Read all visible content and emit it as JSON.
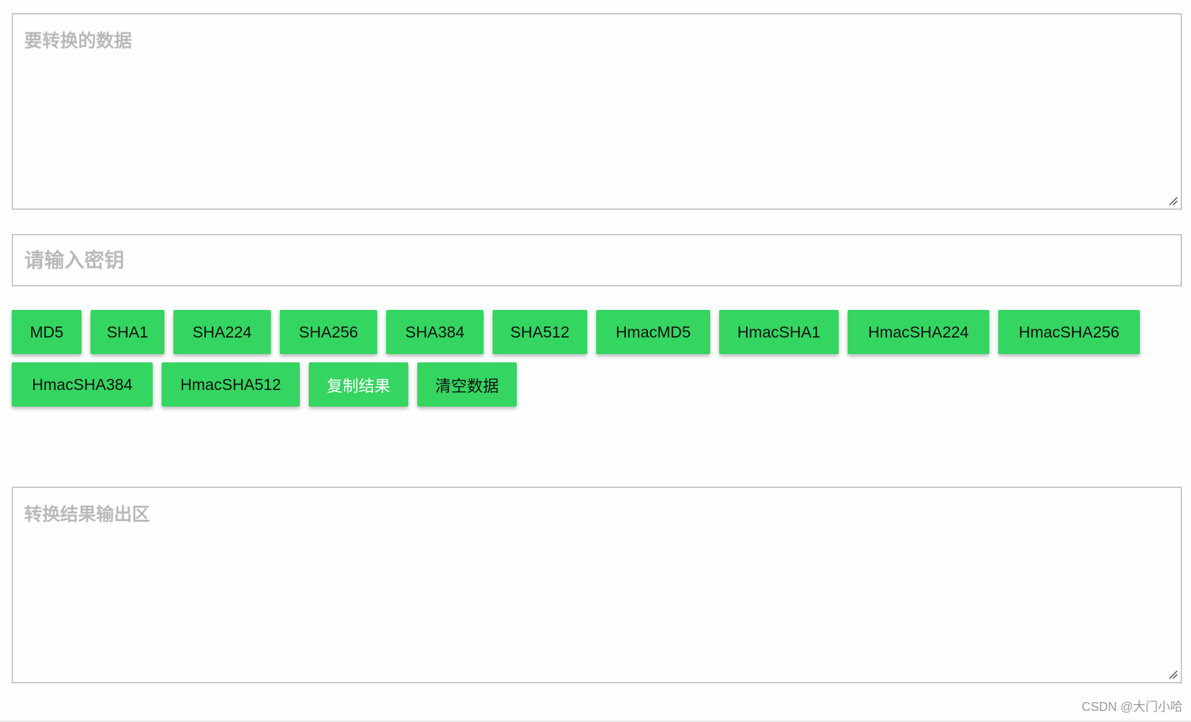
{
  "input_area": {
    "placeholder": "要转换的数据",
    "value": ""
  },
  "key_input": {
    "placeholder": "请输入密钥",
    "value": ""
  },
  "buttons_row1": [
    {
      "label": "MD5"
    },
    {
      "label": "SHA1"
    },
    {
      "label": "SHA224"
    },
    {
      "label": "SHA256"
    },
    {
      "label": "SHA384"
    },
    {
      "label": "SHA512"
    },
    {
      "label": "HmacMD5"
    },
    {
      "label": "HmacSHA1"
    },
    {
      "label": "HmacSHA224"
    },
    {
      "label": "HmacSHA256"
    }
  ],
  "buttons_row2": [
    {
      "label": "HmacSHA384"
    },
    {
      "label": "HmacSHA512"
    },
    {
      "label": "复制结果"
    },
    {
      "label": "清空数据"
    }
  ],
  "output_area": {
    "placeholder": "转换结果输出区",
    "value": ""
  },
  "watermark": "CSDN @大门小哈",
  "colors": {
    "button_bg": "#35d562",
    "border": "#c8c8c8",
    "placeholder": "#b9b9b9"
  }
}
